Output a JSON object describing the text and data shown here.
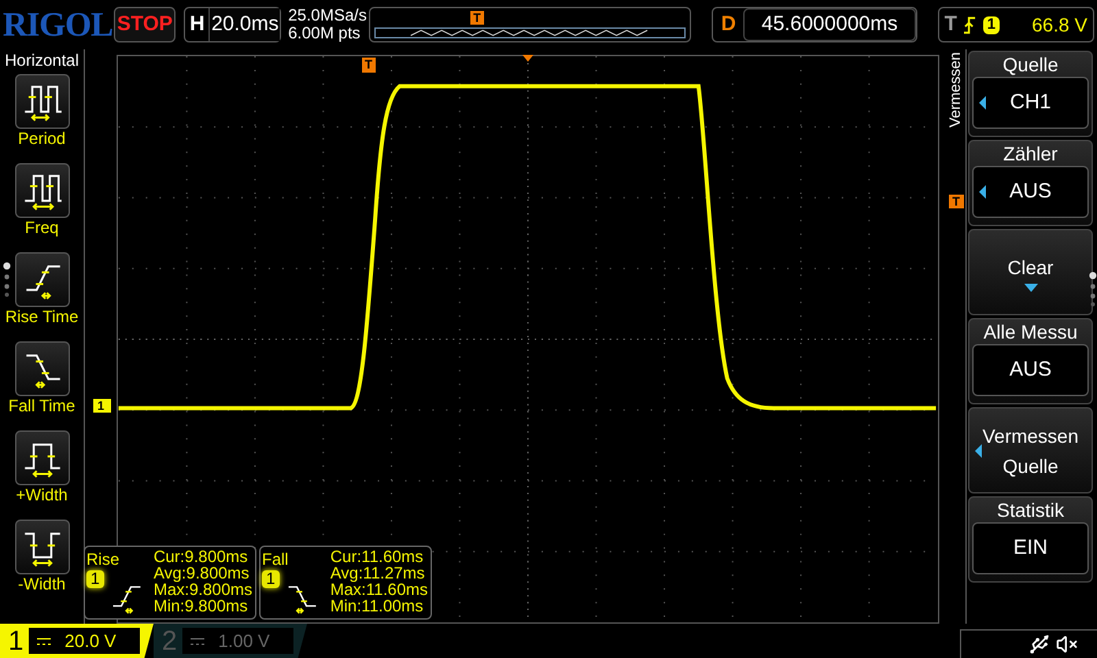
{
  "brand": "RIGOL",
  "run_state": "STOP",
  "horizontal": {
    "label": "H",
    "timebase": "20.0ms"
  },
  "acquisition": {
    "sample_rate": "25.0MSa/s",
    "memory_depth": "6.00M pts",
    "trigger_position_marker": "T"
  },
  "delay": {
    "label": "D",
    "value": "45.6000000ms"
  },
  "trigger": {
    "label": "T",
    "channel": "1",
    "level": "66.8 V"
  },
  "left_menu": {
    "title": "Horizontal",
    "items": [
      {
        "kind": "period",
        "label": "Period"
      },
      {
        "kind": "freq",
        "label": "Freq"
      },
      {
        "kind": "rise",
        "label": "Rise Time"
      },
      {
        "kind": "fall",
        "label": "Fall Time"
      },
      {
        "kind": "pwidth",
        "label": "+Width"
      },
      {
        "kind": "nwidth",
        "label": "-Width"
      }
    ]
  },
  "screen": {
    "channel_marker": "1",
    "trigger_marker": "T",
    "trigger_level_marker": "T"
  },
  "measurements": [
    {
      "kind": "rise",
      "name": "Rise",
      "channel": "1",
      "stats": [
        "Cur:9.800ms",
        "Avg:9.800ms",
        "Max:9.800ms",
        "Min:9.800ms"
      ]
    },
    {
      "kind": "fall",
      "name": "Fall",
      "channel": "1",
      "stats": [
        "Cur:11.60ms",
        "Avg:11.27ms",
        "Max:11.60ms",
        "Min:11.00ms"
      ]
    }
  ],
  "right_menu": {
    "tab": "Vermessen",
    "items": [
      {
        "kind": "option",
        "title": "Quelle",
        "value": "CH1",
        "arrow": true
      },
      {
        "kind": "option",
        "title": "Zähler",
        "value": "AUS",
        "arrow": true
      },
      {
        "kind": "action",
        "lines": [
          "Clear"
        ],
        "arrow": false,
        "dropdown": true
      },
      {
        "kind": "option",
        "title": "Alle Messu",
        "value": "AUS",
        "arrow": false
      },
      {
        "kind": "action",
        "lines": [
          "Vermessen",
          "Quelle"
        ],
        "arrow": true,
        "dropdown": false
      },
      {
        "kind": "option",
        "title": "Statistik",
        "value": "EIN",
        "arrow": false
      }
    ]
  },
  "channels": [
    {
      "number": "1",
      "scale": "20.0 V",
      "active": true
    },
    {
      "number": "2",
      "scale": "1.00 V",
      "active": false
    }
  ]
}
